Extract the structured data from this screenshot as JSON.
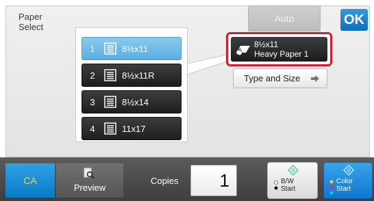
{
  "screen": {
    "title": "Paper\nSelect",
    "title_line1": "Paper",
    "title_line2": "Select"
  },
  "header": {
    "auto_label": "Auto",
    "ok_label": "OK"
  },
  "trays": [
    {
      "number": "1",
      "size": "8½x11",
      "selected": true
    },
    {
      "number": "2",
      "size": "8½x11R",
      "selected": false
    },
    {
      "number": "3",
      "size": "8½x14",
      "selected": false
    },
    {
      "number": "4",
      "size": "11x17",
      "selected": false
    }
  ],
  "paper_info": {
    "size": "8½x11",
    "type": "Heavy Paper 1",
    "highlight_color": "#d41e2d"
  },
  "type_and_size": {
    "label": "Type and Size"
  },
  "bottom_bar": {
    "ca_label": "CA",
    "preview_label": "Preview",
    "copies_label": "Copies",
    "copies_value": "1",
    "bw_start_line1": "B/W",
    "bw_start_line2": "Start",
    "color_start_line1": "Color",
    "color_start_line2": "Start"
  },
  "colors": {
    "accent": "#0d6fbd",
    "selected_tray": "#5aaee2",
    "ca_text": "#f6d92e"
  }
}
